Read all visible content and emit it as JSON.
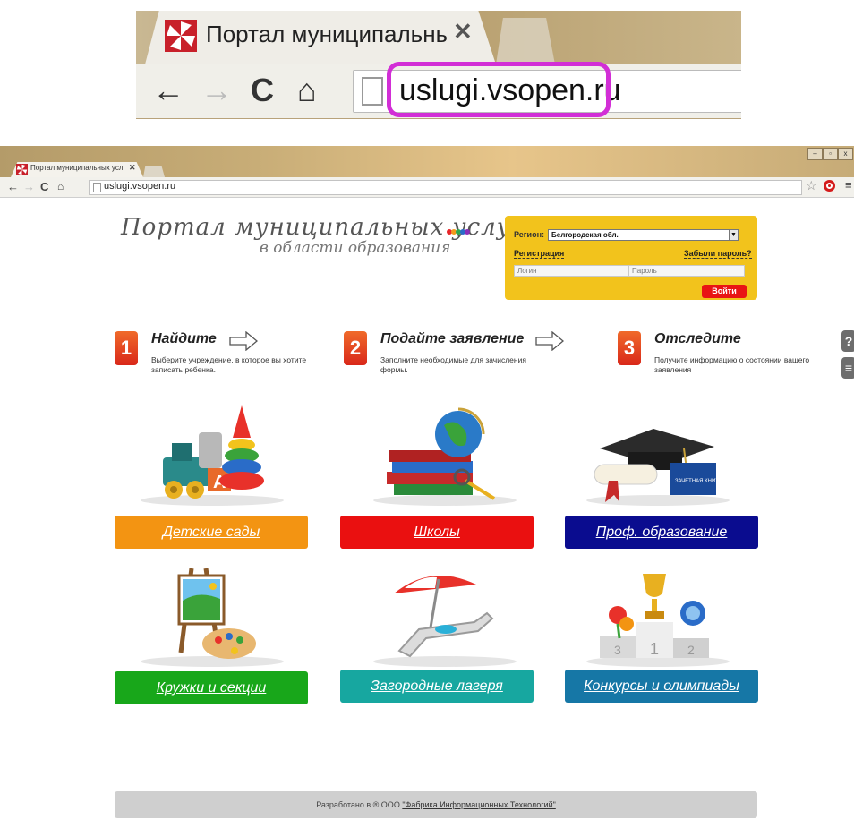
{
  "zoom": {
    "tab_title": "Портал муниципальных усл",
    "url": "uslugi.vsopen.ru",
    "highlight_color": "#d22ed6"
  },
  "browser": {
    "tab_title": "Портал муниципальных усл",
    "url": "uslugi.vsopen.ru",
    "window_buttons": [
      "–",
      "▫",
      "x"
    ]
  },
  "header": {
    "logo_main": "Портал муниципальных услуг",
    "logo_sub": "в области образования",
    "dot_colors": [
      "#e8262a",
      "#f39a1c",
      "#2fa84f",
      "#2a6cc8",
      "#8a2fb8"
    ]
  },
  "login": {
    "region_label": "Регион:",
    "region_value": "Белгородская обл.",
    "register_link": "Регистрация",
    "forgot_link": "Забыли пароль?",
    "login_placeholder": "Логин",
    "password_placeholder": "Пароль",
    "submit_label": "Войти"
  },
  "steps": [
    {
      "num": "1",
      "title": "Найдите",
      "desc": "Выберите учреждение, в которое вы хотите записать ребенка."
    },
    {
      "num": "2",
      "title": "Подайте заявление",
      "desc": "Заполните необходимые для зачисления формы."
    },
    {
      "num": "3",
      "title": "Отследите",
      "desc": "Получите информацию о состоянии вашего заявления"
    }
  ],
  "side_icons": [
    "?",
    "≡"
  ],
  "categories": [
    {
      "label": "Детские сады",
      "color": "#f39412",
      "icon": "toys-icon"
    },
    {
      "label": "Школы",
      "color": "#ea1010",
      "icon": "books-globe-icon"
    },
    {
      "label": "Проф. образование",
      "color": "#0a0c8f",
      "icon": "graduation-cap-icon"
    },
    {
      "label": "Кружки и секции",
      "color": "#18a71a",
      "icon": "easel-palette-icon"
    },
    {
      "label": "Загородные лагеря",
      "color": "#17a7a0",
      "icon": "beach-chair-icon"
    },
    {
      "label": "Конкурсы и олимпиады",
      "color": "#1677a6",
      "icon": "trophy-podium-icon"
    }
  ],
  "footer": {
    "text": "Разработано в ® ООО ",
    "link": "\"Фабрика Информационных Технологий\""
  }
}
